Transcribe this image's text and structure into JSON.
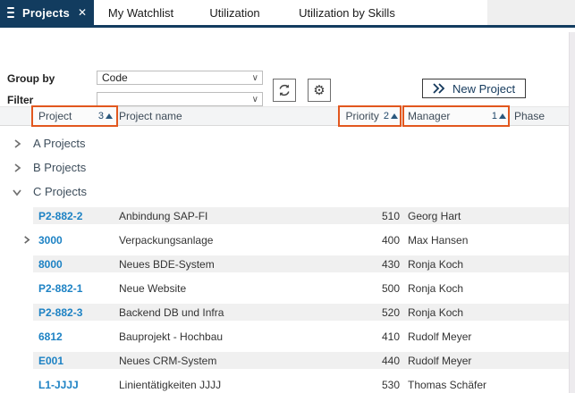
{
  "tabs": {
    "active": {
      "label": "Projects"
    },
    "items": [
      {
        "label": "My Watchlist"
      },
      {
        "label": "Utilization"
      },
      {
        "label": "Utilization by Skills"
      }
    ]
  },
  "toolbar": {
    "group_by_label": "Group by",
    "group_by_value": "Code",
    "filter_label": "Filter",
    "filter_value": "",
    "new_project_label": "New Project"
  },
  "table": {
    "columns": [
      {
        "label": "Project",
        "sort_order": "3",
        "sort_dir": "asc",
        "highlighted": true
      },
      {
        "label": "Project name",
        "highlighted": false
      },
      {
        "label": "Priority",
        "sort_order": "2",
        "sort_dir": "asc",
        "highlighted": true
      },
      {
        "label": "Manager",
        "sort_order": "1",
        "sort_dir": "asc",
        "highlighted": true
      },
      {
        "label": "Phase",
        "highlighted": false
      }
    ],
    "groups": [
      {
        "label": "A Projects",
        "expanded": false,
        "rows": []
      },
      {
        "label": "B Projects",
        "expanded": false,
        "rows": []
      },
      {
        "label": "C Projects",
        "expanded": true,
        "rows": [
          {
            "code": "P2-882-2",
            "expandable": false,
            "name": "Anbindung SAP-FI",
            "priority": "510",
            "manager": "Georg Hart",
            "phase": ""
          },
          {
            "code": "3000",
            "expandable": true,
            "name": "Verpackungsanlage",
            "priority": "400",
            "manager": "Max Hansen",
            "phase": ""
          },
          {
            "code": "8000",
            "expandable": false,
            "name": "Neues BDE-System",
            "priority": "430",
            "manager": "Ronja Koch",
            "phase": ""
          },
          {
            "code": "P2-882-1",
            "expandable": false,
            "name": "Neue Website",
            "priority": "500",
            "manager": "Ronja Koch",
            "phase": ""
          },
          {
            "code": "P2-882-3",
            "expandable": false,
            "name": "Backend DB und Infra",
            "priority": "520",
            "manager": "Ronja Koch",
            "phase": ""
          },
          {
            "code": "6812",
            "expandable": false,
            "name": "Bauprojekt - Hochbau",
            "priority": "410",
            "manager": "Rudolf Meyer",
            "phase": ""
          },
          {
            "code": "E001",
            "expandable": false,
            "name": "Neues CRM-System",
            "priority": "440",
            "manager": "Rudolf Meyer",
            "phase": ""
          },
          {
            "code": "L1-JJJJ",
            "expandable": false,
            "name": "Linientätigkeiten JJJJ",
            "priority": "530",
            "manager": "Thomas Schäfer",
            "phase": ""
          }
        ]
      }
    ]
  },
  "colors": {
    "accent_navy": "#123c5f",
    "link_blue": "#1d82c4",
    "annotation_orange": "#e2571e",
    "stripe_gray": "#f0f0f0"
  }
}
